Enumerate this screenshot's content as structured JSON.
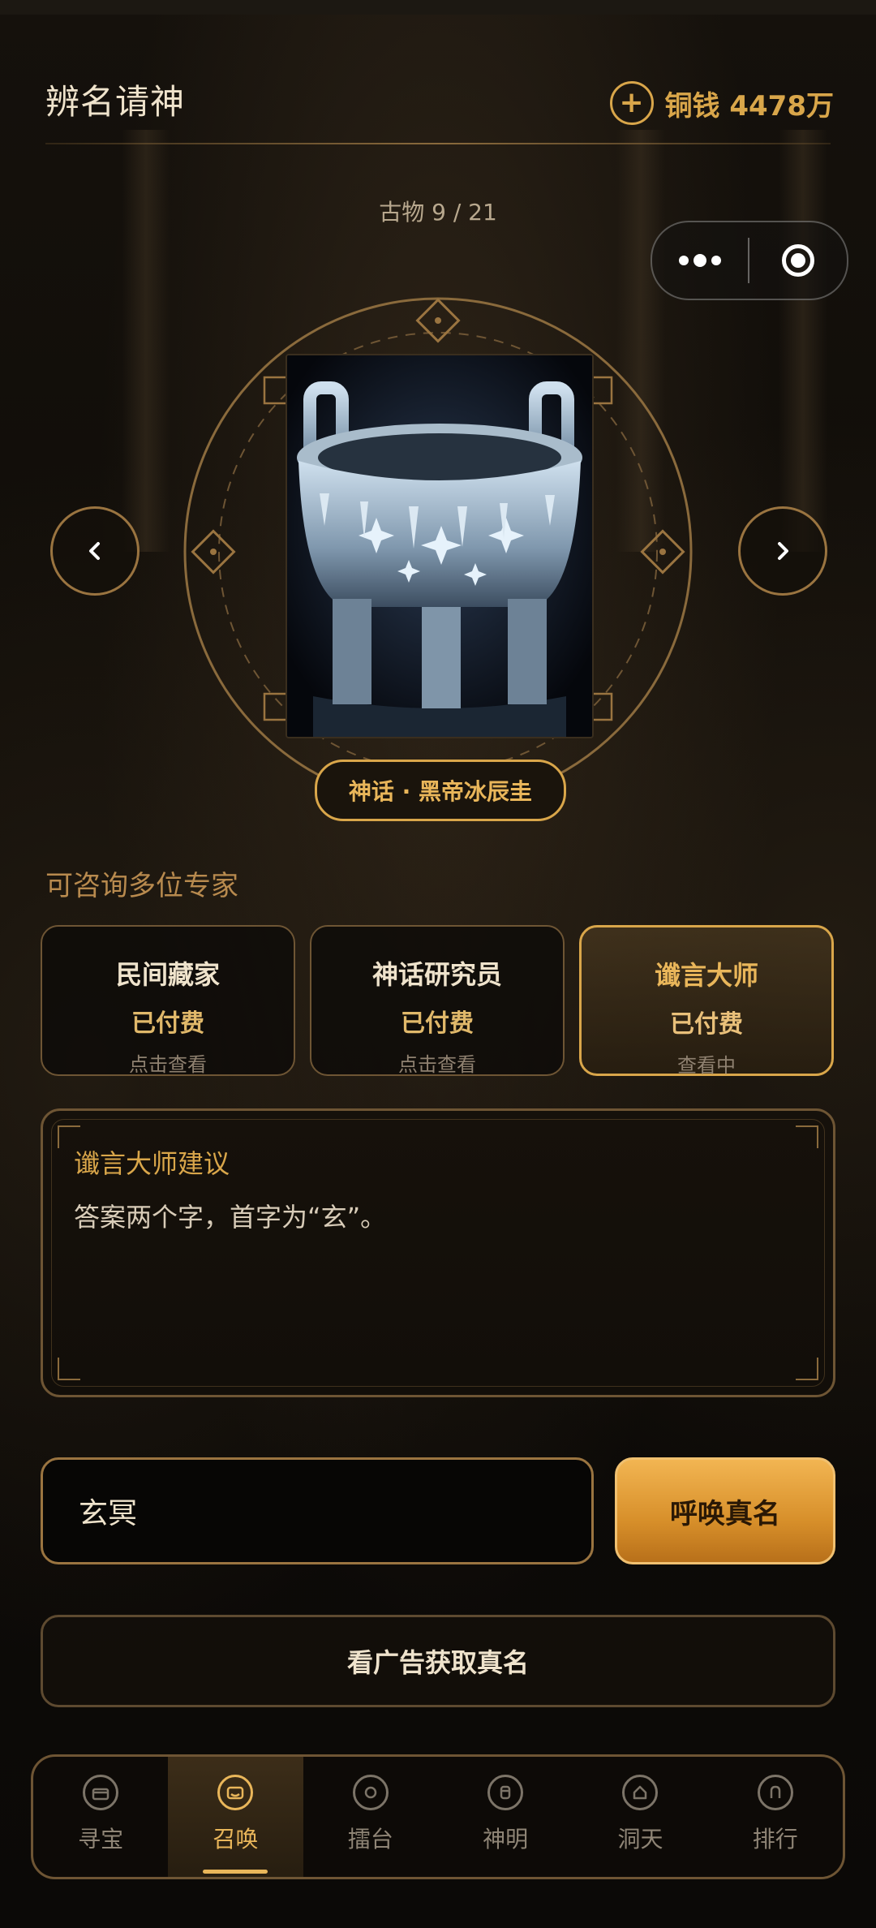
{
  "header": {
    "title": "辨名请神",
    "coin_text": "铜钱 4478万",
    "add_icon": "plus-circle-icon"
  },
  "artifact": {
    "counter": "古物 9 / 21",
    "name": "神话 · 黑帝冰辰圭",
    "image": "frozen-bronze-ding-cauldron"
  },
  "experts": {
    "label": "可咨询多位专家",
    "items": [
      {
        "name": "民间藏家",
        "status": "已付费",
        "hint": "点击查看"
      },
      {
        "name": "神话研究员",
        "status": "已付费",
        "hint": "点击查看"
      },
      {
        "name": "谶言大师",
        "status": "已付费",
        "hint": "查看中"
      }
    ]
  },
  "advice": {
    "title": "谶言大师建议",
    "text": "答案两个字，首字为“玄”。"
  },
  "answer": {
    "value": "玄冥"
  },
  "buttons": {
    "summon": "呼唤真名",
    "ad": "看广告获取真名"
  },
  "tabbar": {
    "items": [
      {
        "label": "寻宝",
        "icon": "treasure-icon"
      },
      {
        "label": "召唤",
        "icon": "summon-icon"
      },
      {
        "label": "擂台",
        "icon": "arena-icon"
      },
      {
        "label": "神明",
        "icon": "deity-icon"
      },
      {
        "label": "洞天",
        "icon": "home-icon"
      },
      {
        "label": "排行",
        "icon": "rank-icon"
      }
    ],
    "active": "召唤"
  },
  "colors": {
    "accent": "#d9a64a",
    "background": "#0b0907",
    "summon_button": "#e6a03c"
  }
}
